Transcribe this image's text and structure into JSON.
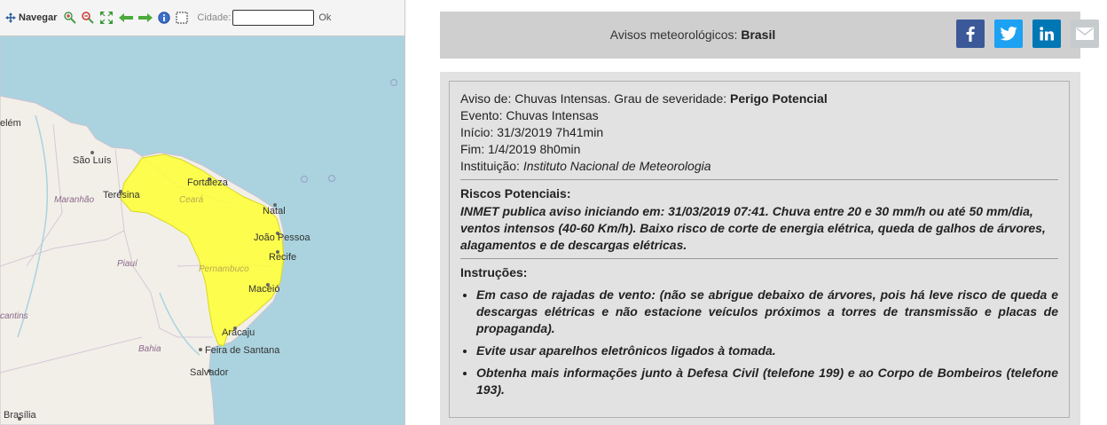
{
  "toolbar": {
    "navigate_label": "Navegar",
    "city_label": "Cidade:",
    "city_value": "",
    "ok_label": "Ok"
  },
  "map": {
    "cities": {
      "belem": "elém",
      "sao_luis": "São Luís",
      "teresina": "Teresina",
      "fortaleza": "Fortaleza",
      "natal": "Natal",
      "joao_pessoa": "João Pessoa",
      "recife": "Recife",
      "maceio": "Maceió",
      "aracaju": "Aracaju",
      "feira": "Feira de Santana",
      "salvador": "Salvador",
      "brasilia": "Brasília"
    },
    "states": {
      "maranhao": "Maranhão",
      "ceara": "Ceará",
      "piaui": "Piauí",
      "pernambuco": "Pernambuco",
      "bahia": "Bahia",
      "tocantins": "cantins"
    },
    "colors": {
      "water": "#aad3df",
      "land": "#f2efe9",
      "alert": "#ffff33"
    }
  },
  "header": {
    "title_prefix": "Avisos meteorológicos: ",
    "title_region": "Brasil"
  },
  "share": {
    "facebook_icon": "facebook-icon",
    "twitter_icon": "twitter-icon",
    "linkedin_icon": "linkedin-icon",
    "email_icon": "email-icon"
  },
  "alert": {
    "aviso_prefix": "Aviso de: Chuvas Intensas. Grau de severidade: ",
    "severity": "Perigo Potencial",
    "evento": "Evento: Chuvas Intensas",
    "inicio": "Início: 31/3/2019 7h41min",
    "fim": "Fim: 1/4/2019 8h0min",
    "instituicao_label": "Instituição: ",
    "instituicao": "Instituto Nacional de Meteorologia",
    "riscos_title": "Riscos Potenciais:",
    "riscos_text": "INMET publica aviso iniciando em: 31/03/2019 07:41. Chuva entre 20 e 30 mm/h ou até 50 mm/dia, ventos intensos (40-60 Km/h). Baixo risco de corte de energia elétrica, queda de galhos de árvores, alagamentos e de descargas elétricas.",
    "instrucoes_title": "Instruções:",
    "instrucoes": [
      "Em caso de rajadas de vento: (não se abrigue debaixo de árvores, pois há leve risco de queda e descargas elétricas e não estacione veículos próximos a torres de transmissão e placas de propaganda).",
      "Evite usar aparelhos eletrônicos ligados à tomada.",
      "Obtenha mais informações junto à Defesa Civil (telefone 199) e ao Corpo de Bombeiros (telefone 193)."
    ]
  }
}
